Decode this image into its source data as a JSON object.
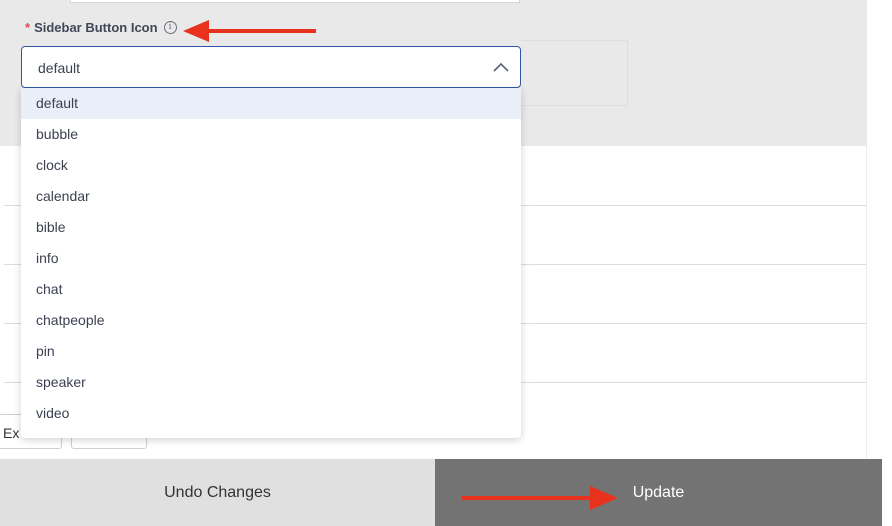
{
  "field": {
    "required_marker": "*",
    "label": "Sidebar Button Icon",
    "info_icon": "info-circle-icon"
  },
  "select": {
    "value": "default",
    "chevron_icon": "chevron-up-icon",
    "options": [
      "default",
      "bubble",
      "clock",
      "calendar",
      "bible",
      "info",
      "chat",
      "chatpeople",
      "pin",
      "speaker",
      "video"
    ],
    "selected_index": 0
  },
  "background": {
    "partial_button_1": "Ex",
    "partial_button_2": ""
  },
  "footer": {
    "undo_label": "Undo Changes",
    "update_label": "Update"
  },
  "colors": {
    "accent": "#2f56a8",
    "required": "#e5484d",
    "annotation_arrow": "#e8321e",
    "update_bg": "#737373",
    "undo_bg": "#e0e0e0",
    "selected_option_bg": "#e9eef9"
  },
  "annotations": {
    "arrow_icon": "red-arrow-icon"
  }
}
